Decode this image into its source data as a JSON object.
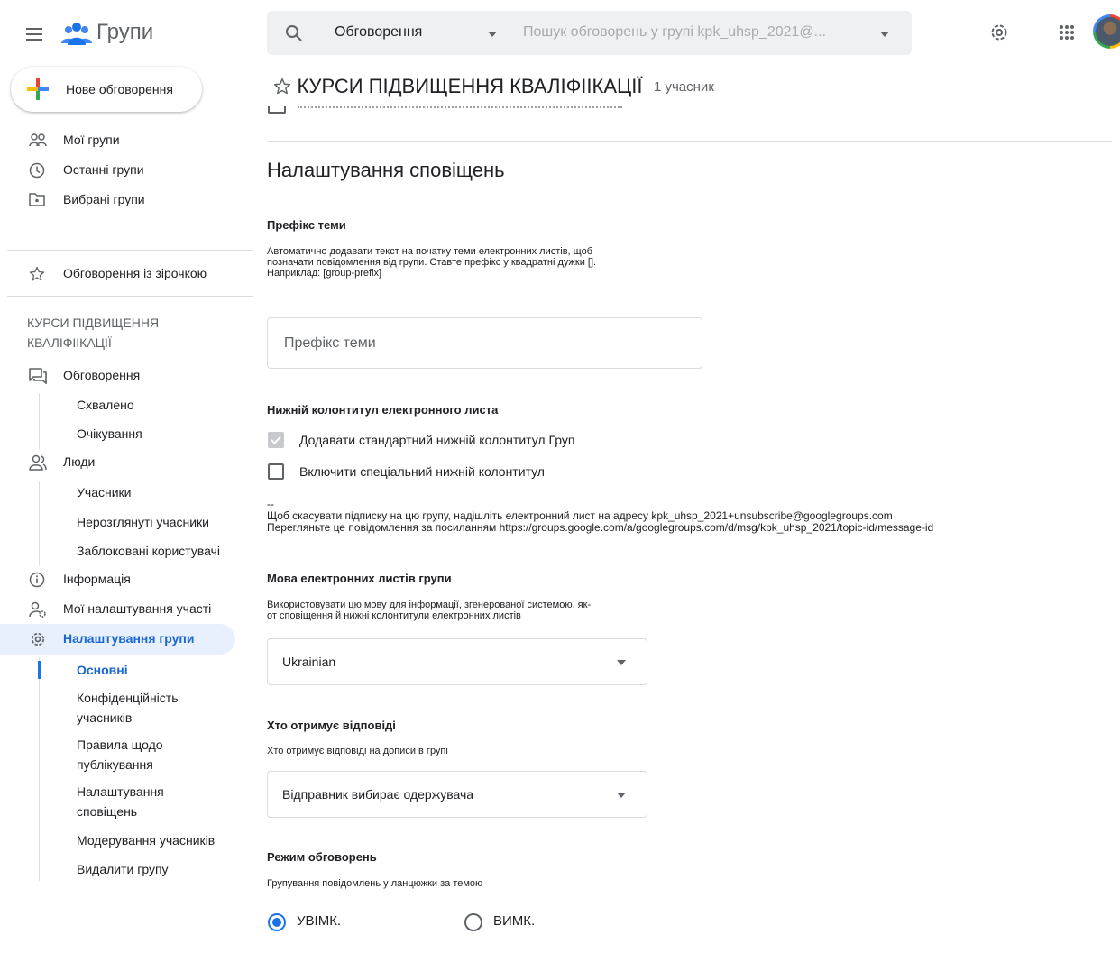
{
  "app": {
    "title": "Групи"
  },
  "search": {
    "scope": "Обговорення",
    "placeholder": "Пошук обговорень у групі kpk_uhsp_2021@..."
  },
  "sidebar": {
    "new_topic_label": "Нове обговорення",
    "top_items": [
      {
        "label": "Мої групи",
        "icon": "people-outline-icon"
      },
      {
        "label": "Останні групи",
        "icon": "clock-icon"
      },
      {
        "label": "Вибрані групи",
        "icon": "folder-icon"
      }
    ],
    "starred_label": "Обговорення із зірочкою",
    "group_name": "КУРСИ ПІДВИЩЕННЯ КВАЛІФІІКАЦІЇ",
    "conversations": {
      "label": "Обговорення",
      "sub": [
        "Схвалено",
        "Очікування"
      ]
    },
    "people": {
      "label": "Люди",
      "sub": [
        "Учасники",
        "Нерозглянуті учасники",
        "Заблоковані користувачі"
      ]
    },
    "info_label": "Інформація",
    "membership_label": "Мої налаштування участі",
    "group_settings": {
      "label": "Налаштування групи",
      "sub": [
        "Основні",
        "Конфіденційність учасників",
        "Правила щодо публікування",
        "Налаштування сповіщень",
        "Модерування учасників",
        "Видалити групу"
      ]
    }
  },
  "main": {
    "group_title": "КУРСИ ПІДВИЩЕННЯ КВАЛІФІІКАЦІЇ",
    "member_count": "1 учасник",
    "section_title": "Налаштування сповіщень",
    "subject_prefix": {
      "label": "Префікс теми",
      "description": [
        "Автоматично додавати текст на початку теми електронних листів, щоб",
        "позначати повідомлення від групи. Ставте префікс у квадратні дужки [].",
        "Наприклад: [group-prefix]"
      ],
      "placeholder": "Префікс теми",
      "value": ""
    },
    "email_footer": {
      "label": "Нижній колонтитул електронного листа",
      "option_default": {
        "label": "Додавати стандартний нижній колонтитул Груп",
        "checked": true
      },
      "option_custom": {
        "label": "Включити спеціальний нижній колонтитул",
        "checked": false
      },
      "preview": [
        "--",
        "Щоб скасувати підписку на цю групу, надішліть електронний лист на адресу kpk_uhsp_2021+unsubscribe@googlegroups.com",
        "Перегляньте це повідомлення за посиланням https://groups.google.com/a/googlegroups.com/d/msg/kpk_uhsp_2021/topic-id/message-id"
      ]
    },
    "language": {
      "label": "Мова електронних листів групи",
      "description": [
        "Використовувати цю мову для інформації, згенерованої системою, як-",
        "от сповіщення й нижні колонтитули електронних листів"
      ],
      "value": "Ukrainian"
    },
    "reply_to": {
      "label": "Хто отримує відповіді",
      "description": "Хто отримує відповіді на дописи в групі",
      "value": "Відправник вибирає одержувача"
    },
    "conversation_mode": {
      "label": "Режим обговорень",
      "description": "Групування повідомлень у ланцюжки за темою",
      "on_label": "УВІМК.",
      "off_label": "ВИМК.",
      "selected": "on"
    }
  },
  "colors": {
    "accent": "#1a73e8",
    "active_bg": "#e8f0fe",
    "divider": "#dadce0"
  }
}
